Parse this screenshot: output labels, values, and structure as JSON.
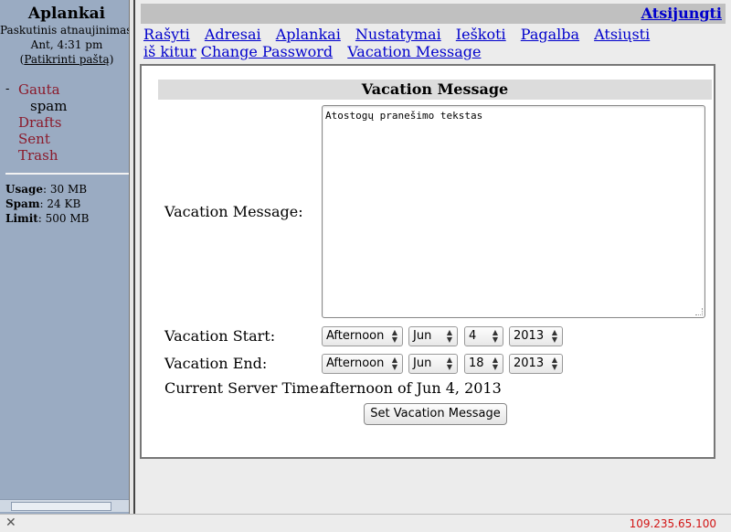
{
  "sidebar": {
    "title": "Aplankai",
    "last_refresh": "Paskutinis atnaujinimas:",
    "time": "Ant, 4:31 pm",
    "check_mail_open": "(",
    "check_mail": "Patikrinti paštą",
    "check_mail_close": ")",
    "folders": [
      {
        "bullet": "-",
        "label": "Gauta"
      },
      {
        "bullet": "",
        "label": "spam"
      },
      {
        "bullet": "",
        "label": "Drafts"
      },
      {
        "bullet": "",
        "label": "Sent"
      },
      {
        "bullet": "",
        "label": "Trash"
      }
    ],
    "quota": [
      {
        "label": "Usage",
        "value": ": 30 MB"
      },
      {
        "label": "Spam",
        "value": ": 24 KB"
      },
      {
        "label": "Limit",
        "value": ": 500 MB"
      }
    ]
  },
  "header": {
    "logout": "Atsijungti"
  },
  "nav": {
    "items": [
      "Rašyti",
      "Adresai",
      "Aplankai",
      "Nustatymai",
      "Ieškoti",
      "Pagalba",
      "Atsiųsti iš kitur",
      "Change Password",
      "Vacation Message"
    ]
  },
  "form": {
    "title": "Vacation Message",
    "message_label": "Vacation Message:",
    "message_value": "Atostogų pranešimo tekstas",
    "start_label": "Vacation Start:",
    "start": {
      "period": "Afternoon",
      "month": "Jun",
      "day": "4",
      "year": "2013"
    },
    "end_label": "Vacation End:",
    "end": {
      "period": "Afternoon",
      "month": "Jun",
      "day": "18",
      "year": "2013"
    },
    "server_time_label": "Current Server Time:",
    "server_time_value": "afternoon of Jun 4, 2013",
    "submit": "Set Vacation Message"
  },
  "statusbar": {
    "ip": "109.235.65.100"
  },
  "colors": {
    "sidebar_bg": "#9aabc2",
    "folder_link": "#8b1a2b",
    "nav_link": "#0000cc",
    "ip_text": "#d21414"
  }
}
